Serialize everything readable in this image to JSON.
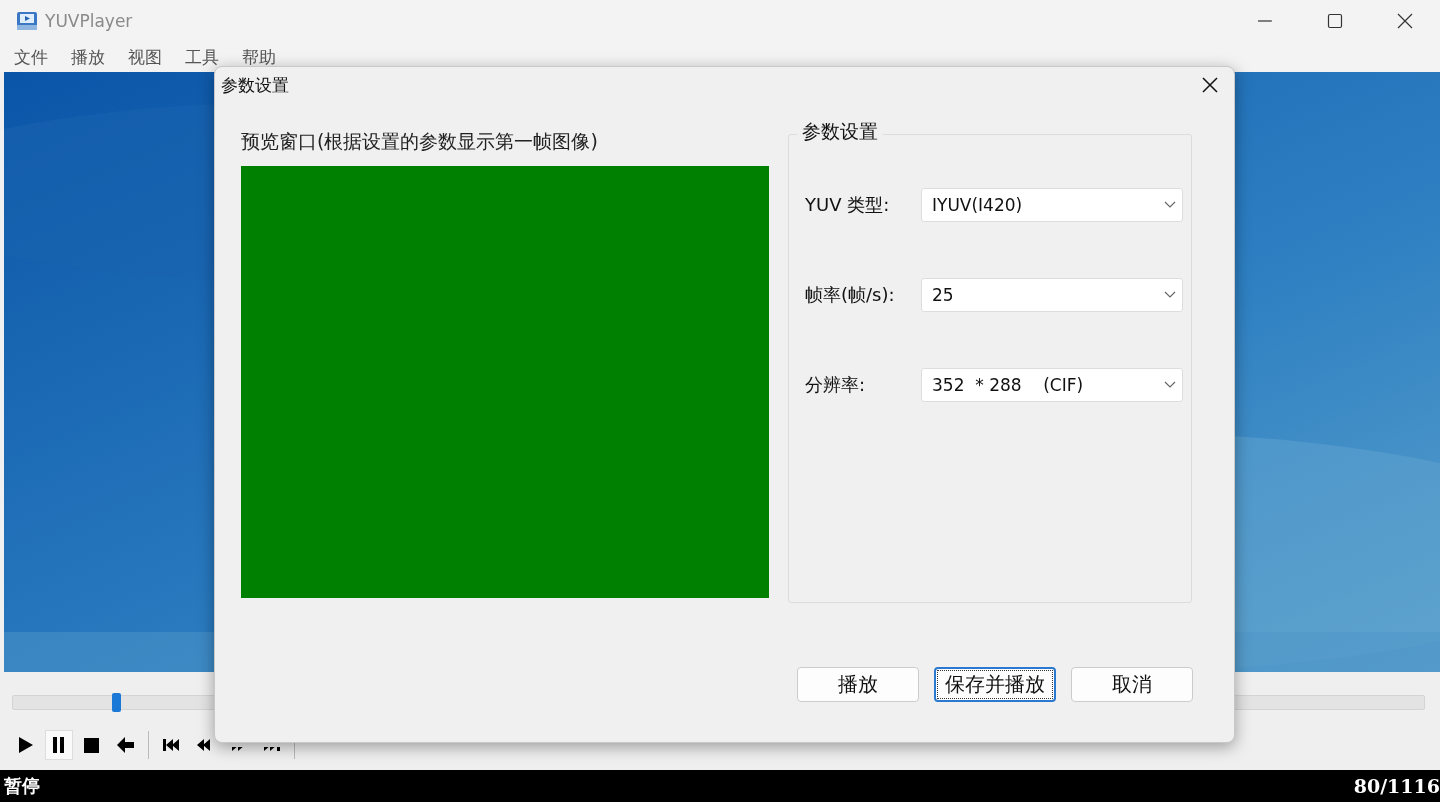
{
  "window": {
    "title": "YUVPlayer"
  },
  "menu": [
    {
      "label": "文件"
    },
    {
      "label": "播放"
    },
    {
      "label": "视图"
    },
    {
      "label": "工具"
    },
    {
      "label": "帮助"
    }
  ],
  "seek": {
    "level": 0.073
  },
  "toolbar": [
    {
      "kind": "play",
      "selected": false
    },
    {
      "kind": "pause",
      "selected": true
    },
    {
      "kind": "stop",
      "selected": false
    },
    {
      "kind": "back",
      "selected": false
    },
    {
      "kind": "separator"
    },
    {
      "kind": "first",
      "selected": false
    },
    {
      "kind": "rewind",
      "selected": false
    },
    {
      "kind": "forward",
      "selected": false
    },
    {
      "kind": "last",
      "selected": false
    },
    {
      "kind": "separator"
    }
  ],
  "status_bar": {
    "state": "暂停",
    "frame": "80/1116"
  },
  "dialog": {
    "title": "参数设置",
    "preview_label": "预览窗口(根据设置的参数显示第一帧图像)",
    "group": {
      "title": "参数设置",
      "fields": [
        {
          "label": "YUV 类型:",
          "value": "IYUV(I420)"
        },
        {
          "label": "帧率(帧/s):",
          "value": "25"
        },
        {
          "label": "分辨率:",
          "value": "352  * 288    (CIF)"
        }
      ]
    },
    "buttons": [
      {
        "label": "播放",
        "focused": false
      },
      {
        "label": "保存并播放",
        "focused": true
      },
      {
        "label": "取消",
        "focused": false
      }
    ]
  }
}
